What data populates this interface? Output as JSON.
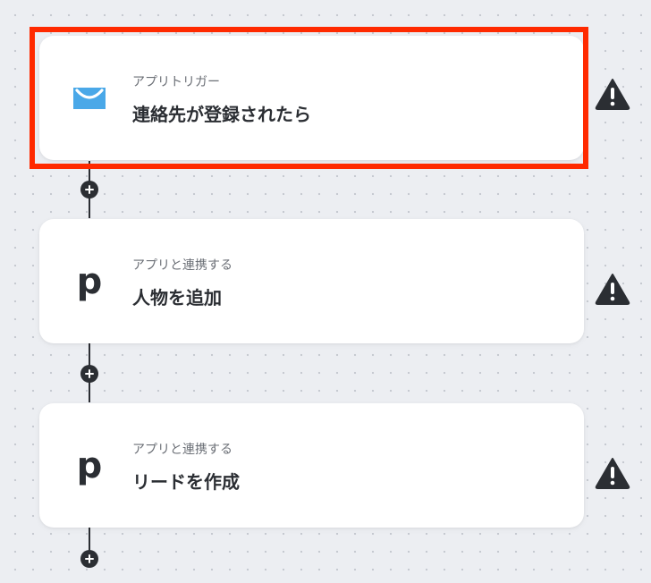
{
  "flow": {
    "steps": [
      {
        "subtitle": "アプリトリガー",
        "title": "連絡先が登録されたら",
        "icon": "getresponse-mail-icon",
        "selected": true
      },
      {
        "subtitle": "アプリと連携する",
        "title": "人物を追加",
        "icon": "pipedrive-p-icon",
        "icon_glyph": "p"
      },
      {
        "subtitle": "アプリと連携する",
        "title": "リードを作成",
        "icon": "pipedrive-p-icon",
        "icon_glyph": "p"
      }
    ]
  },
  "colors": {
    "selection_frame": "#ff2a00",
    "mail_icon": "#4aa8e8",
    "dark": "#2b2e33"
  }
}
